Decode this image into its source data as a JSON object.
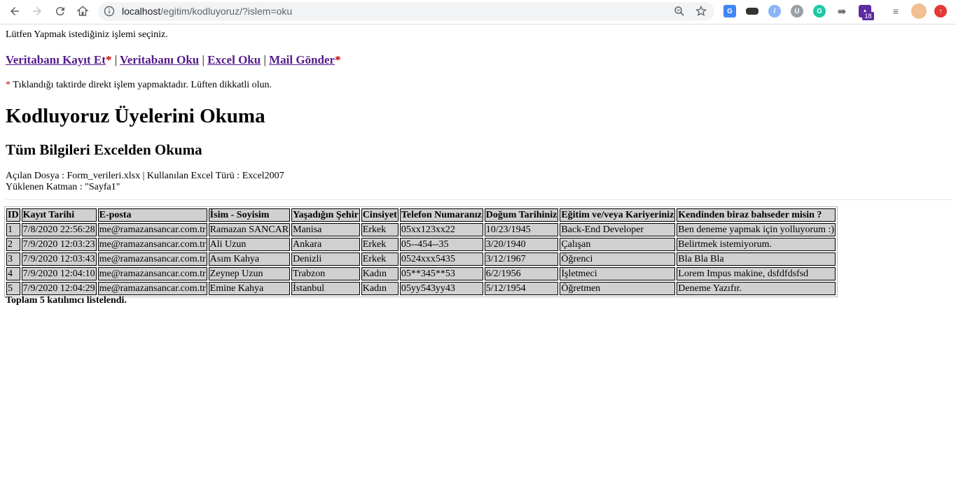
{
  "browser": {
    "url_host": "localhost",
    "url_path": "/egitim/kodluyoruz/?islem=oku",
    "extension_badge": "18"
  },
  "page": {
    "intro": "Lütfen Yapmak istediğiniz işlemi seçiniz.",
    "menu": {
      "db_save": "Veritabanı Kayıt Et",
      "db_read": "Veritabanı Oku",
      "excel_read": "Excel Oku",
      "mail_send": "Mail Gönder",
      "separator": "|",
      "star": "*"
    },
    "note": "Tıklandığı taktirde direkt işlem yapmaktadır. Lüften dikkatli olun.",
    "title": "Kodluyoruz Üyelerini Okuma",
    "subtitle": "Tüm Bilgileri Excelden Okuma",
    "file_line": "Açılan Dosya : Form_verileri.xlsx | Kullanılan Excel Türü : Excel2007",
    "layer_line": "Yüklenen Katman : \"Sayfa1\"",
    "total": "Toplam 5 katılımcı listelendi."
  },
  "table": {
    "headers": [
      "ID",
      "Kayıt Tarihi",
      "E-posta",
      "İsim - Soyisim",
      "Yaşadığın Şehir",
      "Cinsiyet",
      "Telefon Numaranız",
      "Doğum Tarihiniz",
      "Eğitim ve/veya Kariyeriniz",
      "Kendinden biraz bahseder misin ?"
    ],
    "rows": [
      [
        "1",
        "7/8/2020 22:56:28",
        "me@ramazansancar.com.tr",
        "Ramazan SANCAR",
        "Manisa",
        "Erkek",
        "05xx123xx22",
        "10/23/1945",
        "Back-End Developer",
        "Ben deneme yapmak için yolluyorum :)"
      ],
      [
        "2",
        "7/9/2020 12:03:23",
        "me@ramazansancar.com.tr",
        "Ali Uzun",
        "Ankara",
        "Erkek",
        "05--454--35",
        "3/20/1940",
        "Çalışan",
        "Belirtmek istemiyorum."
      ],
      [
        "3",
        "7/9/2020 12:03:43",
        "me@ramazansancar.com.tr",
        "Asım Kahya",
        "Denizli",
        "Erkek",
        "0524xxx5435",
        "3/12/1967",
        "Öğrenci",
        "Bla Bla Bla"
      ],
      [
        "4",
        "7/9/2020 12:04:10",
        "me@ramazansancar.com.tr",
        "Zeynep Uzun",
        "Trabzon",
        "Kadın",
        "05**345**53",
        "6/2/1956",
        "İşletmeci",
        "Lorem Impus makine, dsfdfdsfsd"
      ],
      [
        "5",
        "7/9/2020 12:04:29",
        "me@ramazansancar.com.tr",
        "Emine Kahya",
        "İstanbul",
        "Kadın",
        "05yy543yy43",
        "5/12/1954",
        "Öğretmen",
        "Deneme Yazıfır."
      ]
    ]
  }
}
